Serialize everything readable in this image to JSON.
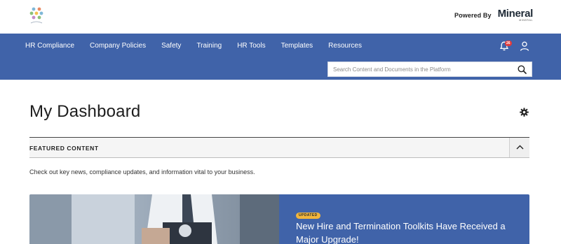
{
  "header": {
    "powered_by": "Powered By",
    "brand_name": "Mineral",
    "brand_sub": "MINERAL"
  },
  "nav": {
    "items": [
      {
        "label": "HR Compliance"
      },
      {
        "label": "Company Policies"
      },
      {
        "label": "Safety"
      },
      {
        "label": "Training"
      },
      {
        "label": "HR Tools"
      },
      {
        "label": "Templates"
      },
      {
        "label": "Resources"
      }
    ],
    "notification_count": "26",
    "notification_icon": "bell-icon",
    "user_icon": "user-icon"
  },
  "search": {
    "placeholder": "Search Content and Documents in the Platform",
    "icon": "search-icon"
  },
  "main": {
    "title": "My Dashboard",
    "settings_icon": "gear-icon",
    "featured": {
      "heading": "FEATURED CONTENT",
      "description": "Check out key news, compliance updates, and information vital to your business.",
      "collapse_icon": "chevron-up-icon"
    },
    "card": {
      "tag": "UPDATED",
      "headline": "New Hire and Termination Toolkits Have Received a Major Upgrade!"
    }
  },
  "colors": {
    "nav_bg": "#4063a9",
    "badge": "#e33b3b",
    "tag": "#f2b53c"
  }
}
